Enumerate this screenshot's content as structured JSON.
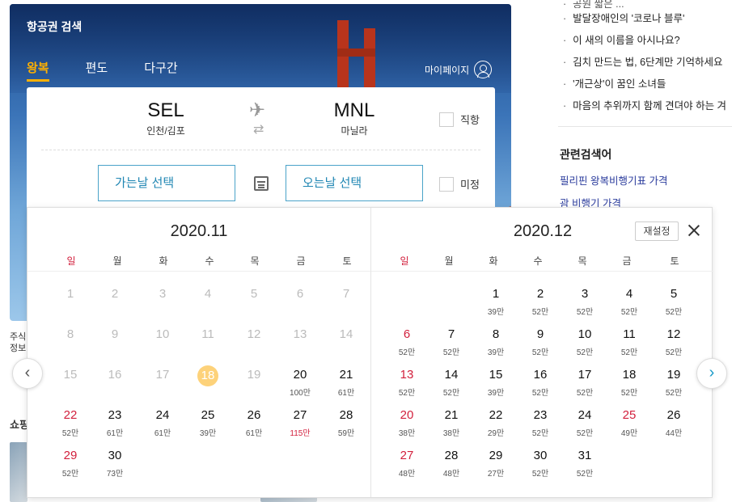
{
  "header": {
    "title": "항공권 검색",
    "tabs": [
      "왕복",
      "편도",
      "다구간"
    ],
    "mypage": "마이페이지"
  },
  "route": {
    "from_code": "SEL",
    "from_city": "인천/김포",
    "to_code": "MNL",
    "to_city": "마닐라"
  },
  "options": {
    "direct": "직항",
    "undecided": "미정"
  },
  "dates": {
    "depart": "가는날 선택",
    "return": "오는날 선택"
  },
  "news": [
    "발달장애인의 '코로나 블루'",
    "이 새의 이름을 아시나요?",
    "김치 만드는 법, 6단계만 기억하세요",
    "'개근상'이 꿈인 소녀들",
    "마음의 추위까지 함께 견뎌야 하는 겨"
  ],
  "news_partial": "공원 짧은 ...",
  "related": {
    "title": "관련검색어",
    "items": [
      "필리핀 왕복비행기표 가격",
      "괌 비행기 가격"
    ]
  },
  "side": {
    "a": "주식",
    "b": "정보",
    "c": "쇼핑"
  },
  "calendar": {
    "reset": "재설정",
    "weekdays": [
      "일",
      "월",
      "화",
      "수",
      "목",
      "금",
      "토"
    ],
    "months": [
      {
        "title": "2020.11",
        "weeks": [
          [
            {
              "d": "1",
              "dis": true
            },
            {
              "d": "2",
              "dis": true
            },
            {
              "d": "3",
              "dis": true
            },
            {
              "d": "4",
              "dis": true
            },
            {
              "d": "5",
              "dis": true
            },
            {
              "d": "6",
              "dis": true
            },
            {
              "d": "7",
              "dis": true
            }
          ],
          [
            {
              "d": "8",
              "dis": true
            },
            {
              "d": "9",
              "dis": true
            },
            {
              "d": "10",
              "dis": true
            },
            {
              "d": "11",
              "dis": true
            },
            {
              "d": "12",
              "dis": true
            },
            {
              "d": "13",
              "dis": true
            },
            {
              "d": "14",
              "dis": true
            }
          ],
          [
            {
              "d": "15",
              "dis": true
            },
            {
              "d": "16",
              "dis": true
            },
            {
              "d": "17",
              "dis": true
            },
            {
              "d": "18",
              "today": true
            },
            {
              "d": "19",
              "dis": true
            },
            {
              "d": "20",
              "p": "100만"
            },
            {
              "d": "21",
              "p": "61만"
            }
          ],
          [
            {
              "d": "22",
              "p": "52만"
            },
            {
              "d": "23",
              "p": "61만"
            },
            {
              "d": "24",
              "p": "61만"
            },
            {
              "d": "25",
              "p": "39만"
            },
            {
              "d": "26",
              "p": "61만"
            },
            {
              "d": "27",
              "p": "115만",
              "hot": true
            },
            {
              "d": "28",
              "p": "59만"
            }
          ],
          [
            {
              "d": "29",
              "p": "52만"
            },
            {
              "d": "30",
              "p": "73만"
            }
          ]
        ]
      },
      {
        "title": "2020.12",
        "weeks": [
          [
            null,
            null,
            {
              "d": "1",
              "p": "39만"
            },
            {
              "d": "2",
              "p": "52만"
            },
            {
              "d": "3",
              "p": "52만"
            },
            {
              "d": "4",
              "p": "52만"
            },
            {
              "d": "5",
              "p": "52만"
            }
          ],
          [
            {
              "d": "6",
              "p": "52만"
            },
            {
              "d": "7",
              "p": "52만"
            },
            {
              "d": "8",
              "p": "39만"
            },
            {
              "d": "9",
              "p": "52만"
            },
            {
              "d": "10",
              "p": "52만"
            },
            {
              "d": "11",
              "p": "52만"
            },
            {
              "d": "12",
              "p": "52만"
            }
          ],
          [
            {
              "d": "13",
              "p": "52만"
            },
            {
              "d": "14",
              "p": "52만"
            },
            {
              "d": "15",
              "p": "39만"
            },
            {
              "d": "16",
              "p": "52만"
            },
            {
              "d": "17",
              "p": "52만"
            },
            {
              "d": "18",
              "p": "52만"
            },
            {
              "d": "19",
              "p": "52만"
            }
          ],
          [
            {
              "d": "20",
              "p": "38만"
            },
            {
              "d": "21",
              "p": "38만"
            },
            {
              "d": "22",
              "p": "29만"
            },
            {
              "d": "23",
              "p": "52만"
            },
            {
              "d": "24",
              "p": "52만"
            },
            {
              "d": "25",
              "p": "49만",
              "sun": true
            },
            {
              "d": "26",
              "p": "44만"
            }
          ],
          [
            {
              "d": "27",
              "p": "48만"
            },
            {
              "d": "28",
              "p": "48만"
            },
            {
              "d": "29",
              "p": "27만"
            },
            {
              "d": "30",
              "p": "52만"
            },
            {
              "d": "31",
              "p": "52만"
            }
          ]
        ]
      }
    ]
  }
}
